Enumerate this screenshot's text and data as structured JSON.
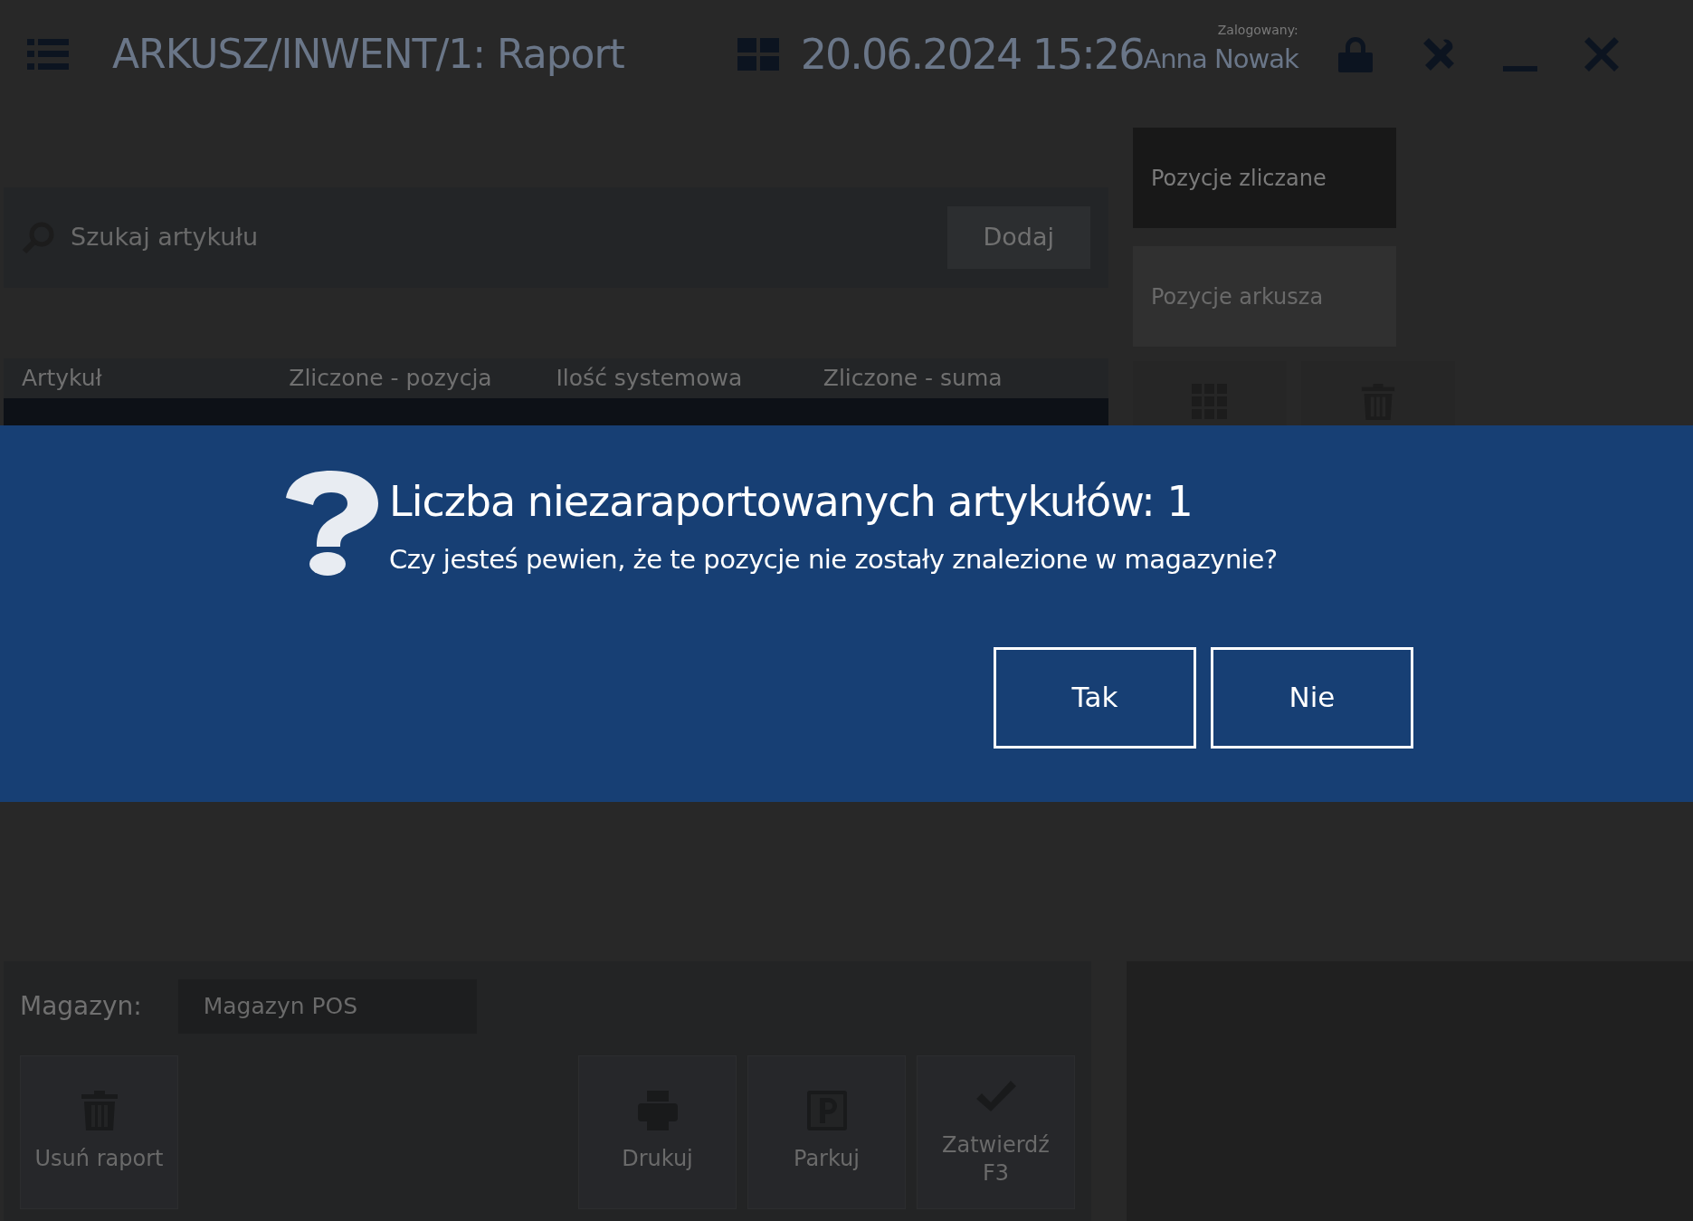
{
  "header": {
    "title": "ARKUSZ/INWENT/1: Raport",
    "datetime": "20.06.2024 15:26",
    "user_label": "Zalogowany:",
    "user_name": "Anna Nowak"
  },
  "search": {
    "placeholder": "Szukaj artykułu",
    "add_button": "Dodaj"
  },
  "side_tabs": [
    {
      "label": "Pozycje zliczane",
      "selected": true
    },
    {
      "label": "Pozycje arkusza",
      "selected": false
    }
  ],
  "table": {
    "columns": [
      "Artykuł",
      "Zliczone - pozycja",
      "Ilość systemowa",
      "Zliczone - suma"
    ]
  },
  "dialog": {
    "title": "Liczba niezaraportowanych artykułów: 1",
    "message": "Czy jesteś pewien, że te pozycje nie zostały znalezione w magazynie?",
    "buttons": [
      "Tak",
      "Nie"
    ]
  },
  "footer": {
    "warehouse_label": "Magazyn:",
    "warehouse_value": "Magazyn POS",
    "actions": [
      {
        "label": "Usuń raport"
      },
      {
        "label": "Drukuj"
      },
      {
        "label": "Parkuj"
      },
      {
        "label": "Zatwierdź",
        "hotkey": "F3"
      }
    ]
  }
}
